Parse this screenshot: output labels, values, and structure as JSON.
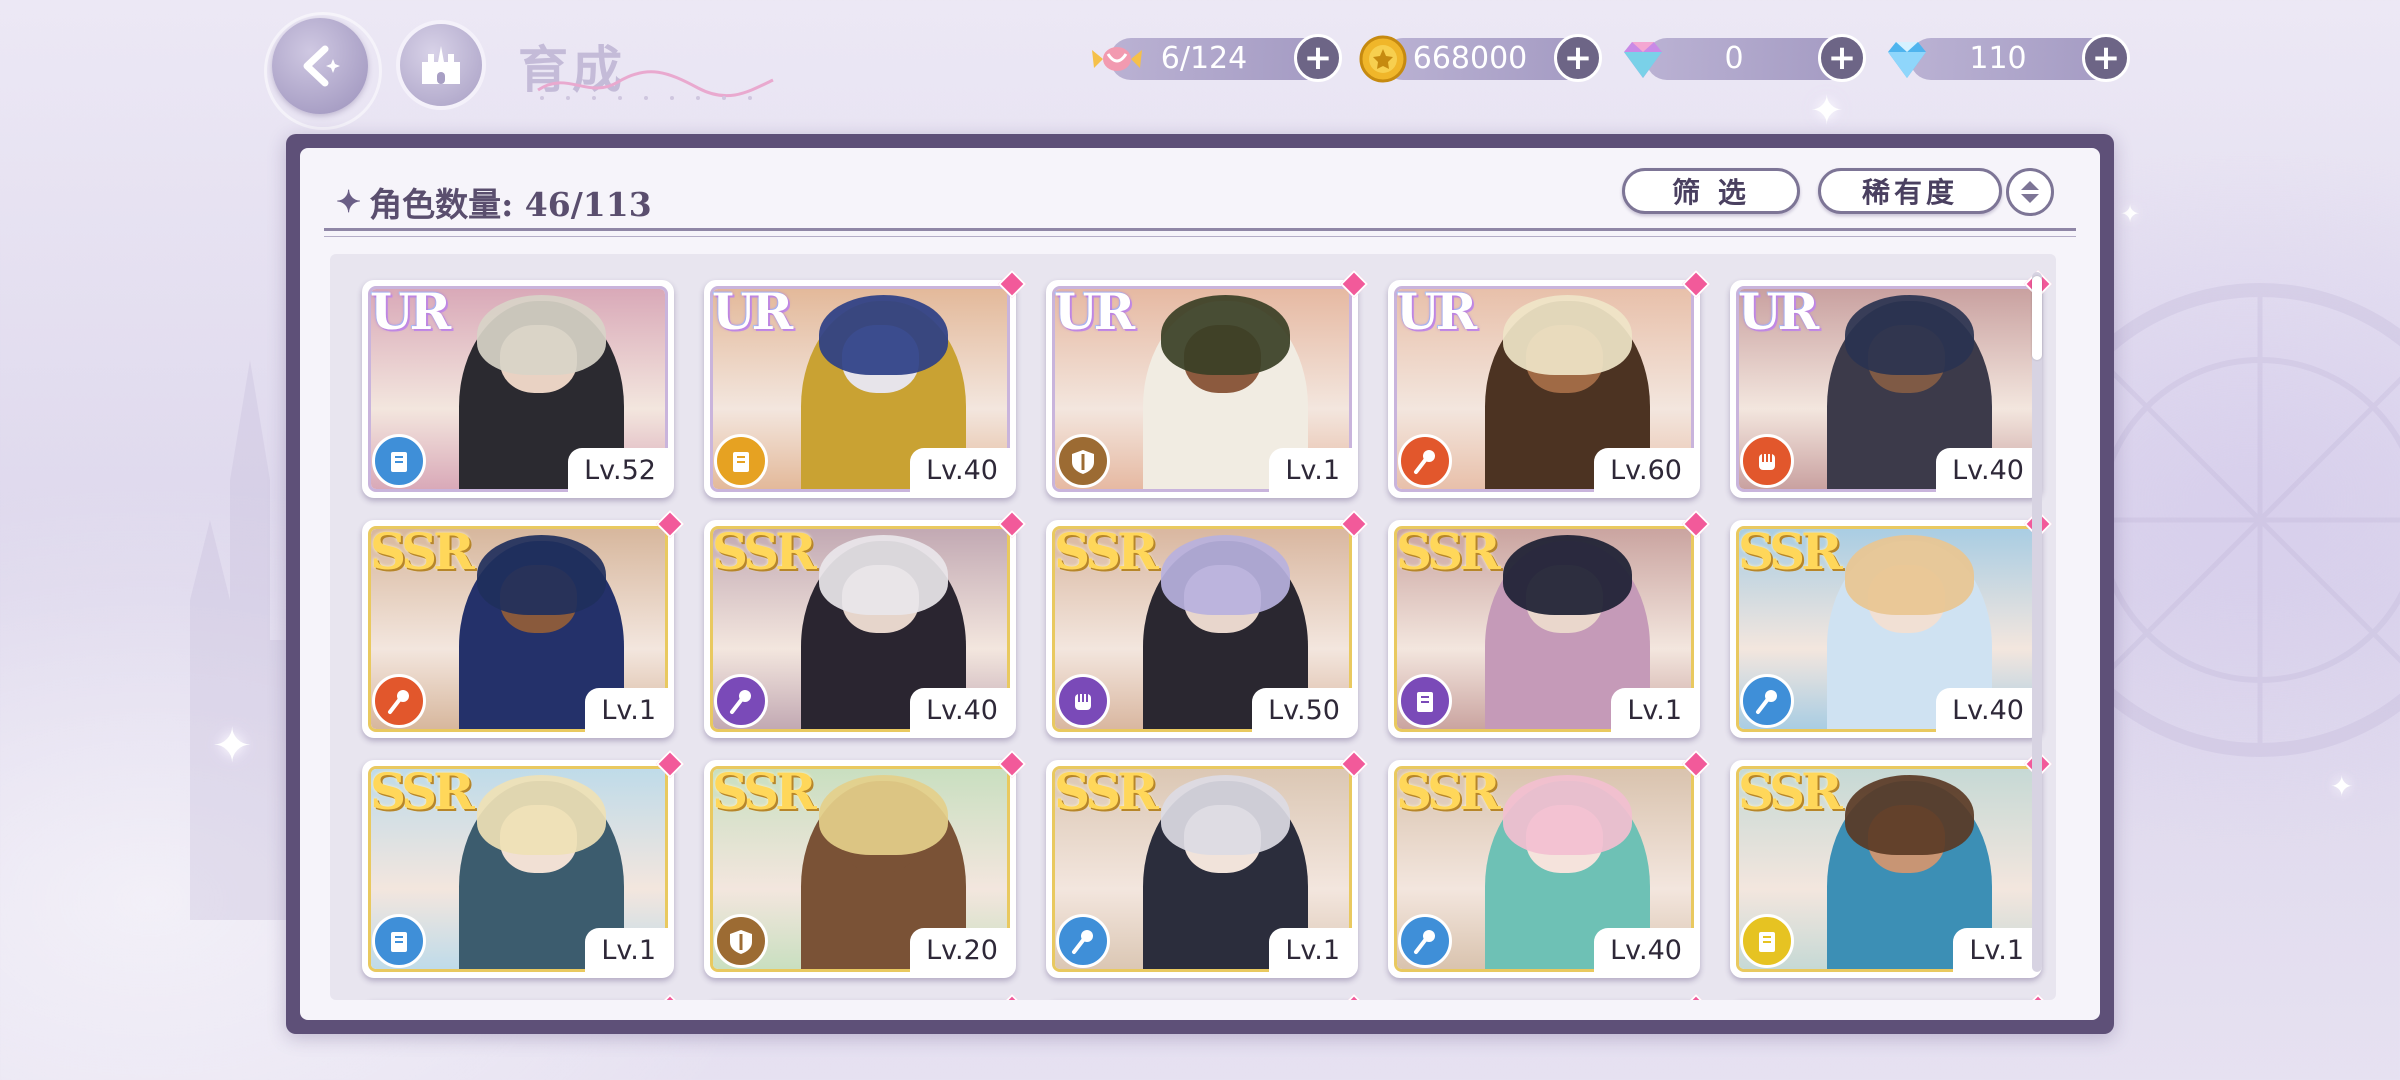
{
  "header": {
    "title": "育成",
    "back_icon": "back-arrow-icon",
    "home_icon": "castle-home-icon"
  },
  "resources": [
    {
      "id": "stamina",
      "icon": "candy-icon",
      "value": "6/124"
    },
    {
      "id": "gold",
      "icon": "gold-coin-icon",
      "value": "668000"
    },
    {
      "id": "colored_gem",
      "icon": "rainbow-gem-icon",
      "value": "0"
    },
    {
      "id": "diamond",
      "icon": "blue-diamond-icon",
      "value": "110"
    }
  ],
  "panel": {
    "count_label": "角色数量: 46/113",
    "filter_label": "筛 选",
    "rarity_sort_label": "稀有度",
    "sort_toggle_icon": "sort-updown-icon"
  },
  "colors": {
    "panel_frame": "#5e5078",
    "panel_bg": "#f6f4fa",
    "accent_pink": "#f25a9a",
    "ur_frame": "#c9b4dc",
    "ssr_frame": "#e9c95f"
  },
  "cards": [
    {
      "rarity": "UR",
      "level": "Lv.52",
      "role": "book",
      "role_color": "#3f8fd8",
      "bg": "#d9a9b8",
      "hair": "#d8d4c8",
      "skin": "#e9d2c3",
      "outfit": "#2b2a30",
      "new": false
    },
    {
      "rarity": "UR",
      "level": "Lv.40",
      "role": "book",
      "role_color": "#e6a222",
      "bg": "#e3b99a",
      "hair": "#2d3f86",
      "skin": "#e7e4ea",
      "outfit": "#c9a233",
      "new": true
    },
    {
      "rarity": "UR",
      "level": "Lv.1",
      "role": "shield",
      "role_color": "#9c6b33",
      "bg": "#e6b9a2",
      "hair": "#3a3f25",
      "skin": "#8c5a3e",
      "outfit": "#f1ece2",
      "new": true
    },
    {
      "rarity": "UR",
      "level": "Lv.60",
      "role": "staff",
      "role_color": "#e2572c",
      "bg": "#e8c0aa",
      "hair": "#efe5c8",
      "skin": "#a06a45",
      "outfit": "#4c3322",
      "new": true
    },
    {
      "rarity": "UR",
      "level": "Lv.40",
      "role": "fist",
      "role_color": "#e2572c",
      "bg": "#c9a1a0",
      "hair": "#2a3350",
      "skin": "#7f5a45",
      "outfit": "#3c3a4a",
      "new": true
    },
    {
      "rarity": "SSR",
      "level": "Lv.1",
      "role": "staff",
      "role_color": "#e2572c",
      "bg": "#d7b79d",
      "hair": "#1f2f5c",
      "skin": "#8a5a3c",
      "outfit": "#24316a",
      "new": true
    },
    {
      "rarity": "SSR",
      "level": "Lv.40",
      "role": "staff",
      "role_color": "#7a4ab8",
      "bg": "#c2a9b3",
      "hair": "#e9e6ea",
      "skin": "#e6d5cb",
      "outfit": "#2a2530",
      "new": true
    },
    {
      "rarity": "SSR",
      "level": "Lv.50",
      "role": "fist",
      "role_color": "#7a4ab8",
      "bg": "#d9b7a0",
      "hair": "#b7b1de",
      "skin": "#e8d6cc",
      "outfit": "#2a2730",
      "new": true
    },
    {
      "rarity": "SSR",
      "level": "Lv.1",
      "role": "book",
      "role_color": "#7a4ab8",
      "bg": "#caa4a0",
      "hair": "#1c1f33",
      "skin": "#ead7cc",
      "outfit": "#c59ab8",
      "new": true
    },
    {
      "rarity": "SSR",
      "level": "Lv.40",
      "role": "staff",
      "role_color": "#3f8fd8",
      "bg": "#a9cde3",
      "hair": "#e9c691",
      "skin": "#f1e0d4",
      "outfit": "#cfe2f2",
      "new": true
    },
    {
      "rarity": "SSR",
      "level": "Lv.1",
      "role": "book",
      "role_color": "#3f8fd8",
      "bg": "#bfdbe9",
      "hair": "#efe1b5",
      "skin": "#f1e0d4",
      "outfit": "#3c5c6e",
      "new": true
    },
    {
      "rarity": "SSR",
      "level": "Lv.20",
      "role": "shield",
      "role_color": "#9c6b33",
      "bg": "#c9dfc0",
      "hair": "#e4cf8a",
      "skin": "#7a5236",
      "outfit": "#7a5236",
      "new": true
    },
    {
      "rarity": "SSR",
      "level": "Lv.1",
      "role": "staff",
      "role_color": "#3f8fd8",
      "bg": "#dbc7b4",
      "hair": "#dcdbe4",
      "skin": "#f1e3da",
      "outfit": "#2b2d3c",
      "new": true
    },
    {
      "rarity": "SSR",
      "level": "Lv.40",
      "role": "staff",
      "role_color": "#3f8fd8",
      "bg": "#d9c3ae",
      "hair": "#f2bfd0",
      "skin": "#f5e3dc",
      "outfit": "#6ec1b5",
      "new": true
    },
    {
      "rarity": "SSR",
      "level": "Lv.1",
      "role": "book",
      "role_color": "#e6c322",
      "bg": "#c6d9d5",
      "hair": "#5a3a25",
      "skin": "#c89574",
      "outfit": "#3c8fb5",
      "new": true
    }
  ]
}
